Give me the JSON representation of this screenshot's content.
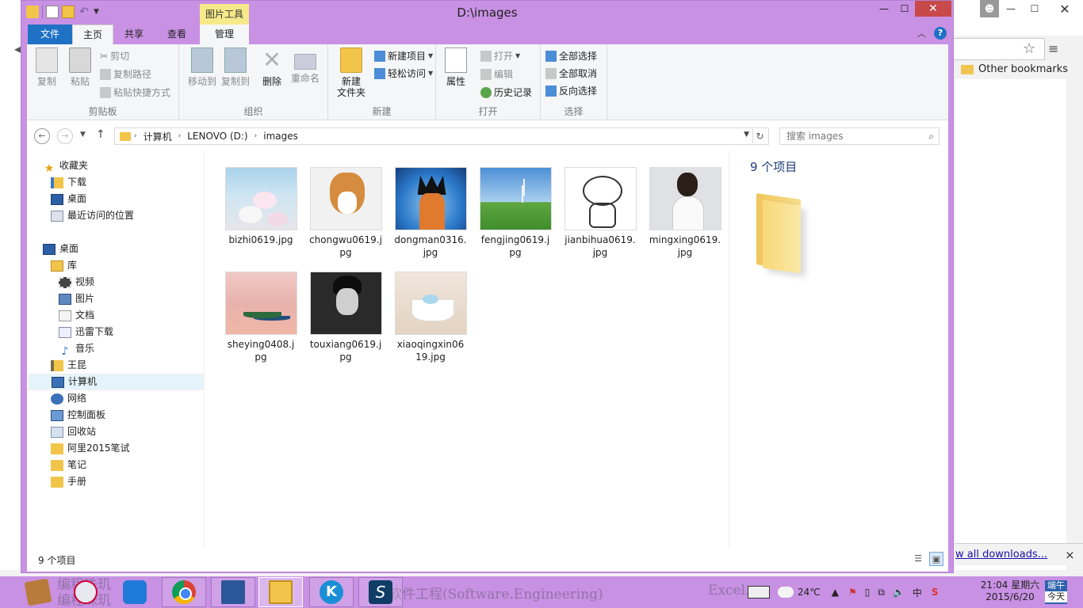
{
  "background_browser": {
    "bookmarks_bar_item": "Other bookmarks",
    "downloads_link": "w all downloads...",
    "downloads_close": "×"
  },
  "window": {
    "title": "D:\\images",
    "context_tab": "图片工具"
  },
  "ribbon_tabs": {
    "file": "文件",
    "home": "主页",
    "share": "共享",
    "view": "查看",
    "manage": "管理"
  },
  "ribbon": {
    "clipboard": {
      "label": "剪贴板",
      "copy": "复制",
      "paste": "粘贴",
      "cut": "剪切",
      "copy_path": "复制路径",
      "paste_shortcut": "粘贴快捷方式"
    },
    "organize": {
      "label": "组织",
      "move_to": "移动到",
      "copy_to": "复制到",
      "delete": "删除",
      "rename": "重命名"
    },
    "new": {
      "label": "新建",
      "new_folder_line1": "新建",
      "new_folder_line2": "文件夹",
      "new_item": "新建项目",
      "easy_access": "轻松访问"
    },
    "open": {
      "label": "打开",
      "properties": "属性",
      "open": "打开",
      "edit": "编辑",
      "history": "历史记录"
    },
    "select": {
      "label": "选择",
      "select_all": "全部选择",
      "select_none": "全部取消",
      "invert": "反向选择"
    }
  },
  "address": {
    "crumbs": [
      "计算机",
      "LENOVO (D:)",
      "images"
    ],
    "search_placeholder": "搜索 images"
  },
  "nav_pane": {
    "favorites": "收藏夹",
    "downloads": "下载",
    "desktop_fav": "桌面",
    "recent": "最近访问的位置",
    "desktop": "桌面",
    "libraries": "库",
    "videos": "视频",
    "pictures": "图片",
    "documents": "文档",
    "xunlei": "迅雷下载",
    "music": "音乐",
    "user": "王昆",
    "computer": "计算机",
    "network": "网络",
    "control_panel": "控制面板",
    "recycle_bin": "回收站",
    "folder1": "阿里2015笔试",
    "folder2": "笔记",
    "folder3": "手册"
  },
  "files": [
    {
      "name": "bizhi0619.jpg"
    },
    {
      "name": "chongwu0619.jpg"
    },
    {
      "name": "dongman0316.jpg"
    },
    {
      "name": "fengjing0619.jpg"
    },
    {
      "name": "jianbihua0619.jpg"
    },
    {
      "name": "mingxing0619.jpg"
    },
    {
      "name": "sheying0408.jpg"
    },
    {
      "name": "touxiang0619.jpg"
    },
    {
      "name": "xiaoqingxin0619.jpg"
    }
  ],
  "preview": {
    "count": "9 个项目"
  },
  "status": {
    "count": "9 个项目"
  },
  "taskbar": {
    "ghost_text_1": "编程珠玑",
    "ghost_text_2": "编程珠玑",
    "ghost_text_3": "软件工程(Software.Engineering)",
    "ghost_text_4": "Excel.co",
    "temperature": "24℃",
    "ime": "中",
    "clock_time": "21:04 星期六",
    "clock_date": "2015/6/20",
    "holiday_top": "端午",
    "holiday_bottom": "今天"
  },
  "colors": {
    "window_frame": "#c891e3",
    "file_tab": "#1f71c6",
    "context_tab": "#f6e98a",
    "close_button": "#c74949"
  }
}
